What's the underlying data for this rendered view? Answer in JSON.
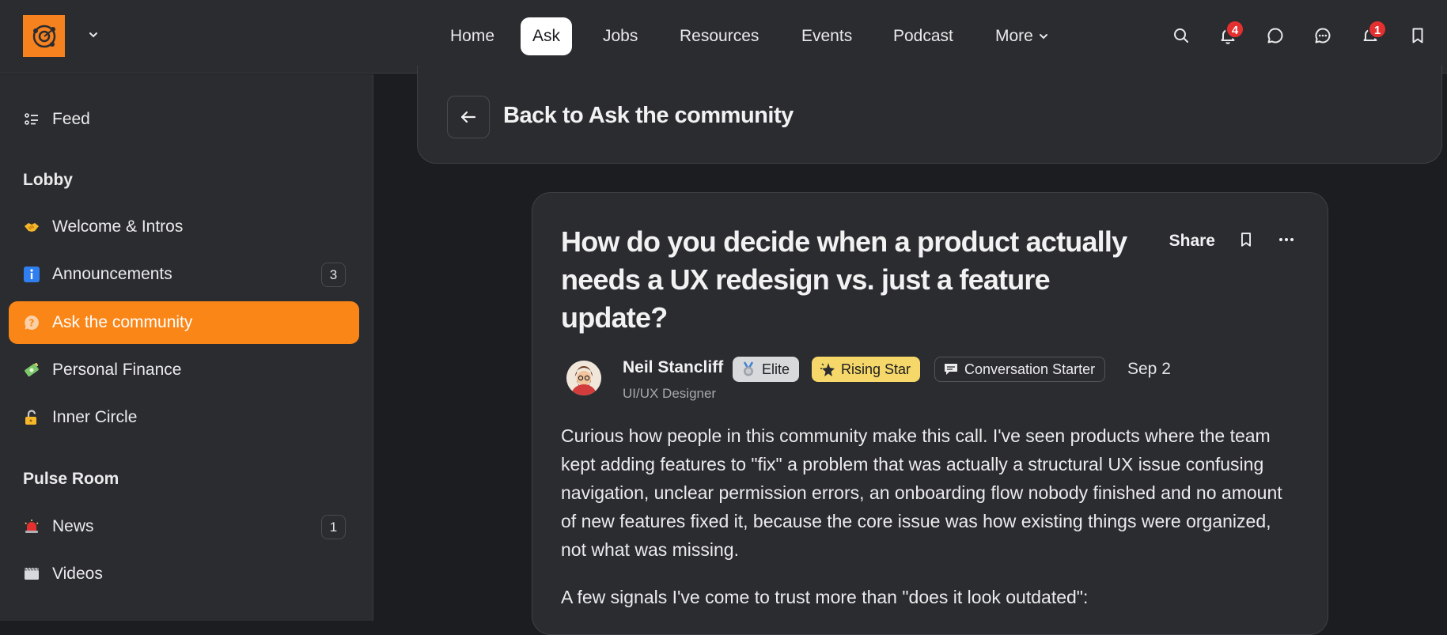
{
  "topbar": {
    "nav": [
      {
        "label": "Home",
        "active": false
      },
      {
        "label": "Ask",
        "active": true
      },
      {
        "label": "Jobs",
        "active": false
      },
      {
        "label": "Resources",
        "active": false
      },
      {
        "label": "Events",
        "active": false
      },
      {
        "label": "Podcast",
        "active": false
      },
      {
        "label": "More",
        "active": false
      }
    ],
    "icons": [
      "search-icon",
      "notifications-icon",
      "chat-icon",
      "messages-icon",
      "activity-icon",
      "bookmark-icon"
    ],
    "notification_badge": "4",
    "activity_badge": "1",
    "brand_color": "#f5821f"
  },
  "sidebar": {
    "feed_label": "Feed",
    "lobby_heading": "Lobby",
    "lobby_items": [
      {
        "label": "Welcome & Intros",
        "icon": "handshake-icon",
        "count": ""
      },
      {
        "label": "Announcements",
        "icon": "info-icon",
        "count": "3"
      },
      {
        "label": "Ask the community",
        "icon": "question-icon",
        "count": "",
        "active": true
      },
      {
        "label": "Personal Finance",
        "icon": "money-icon",
        "count": ""
      },
      {
        "label": "Inner Circle",
        "icon": "lock-icon",
        "count": ""
      }
    ],
    "pulse_heading": "Pulse Room",
    "pulse_items": [
      {
        "label": "News",
        "icon": "siren-icon",
        "count": "1"
      },
      {
        "label": "Videos",
        "icon": "video-icon",
        "count": ""
      }
    ],
    "active_color": "#fa8618"
  },
  "back": {
    "label": "Back to Ask the community"
  },
  "post": {
    "title": "How do you decide when a product actually needs a UX redesign vs. just a feature update?",
    "share_label": "Share",
    "author": {
      "name": "Neil Stancliff",
      "role": "UI/UX Designer"
    },
    "badges": [
      {
        "label": "Elite",
        "icon": "medal-icon"
      },
      {
        "label": "Rising Star",
        "icon": "star-icon"
      },
      {
        "label": "Conversation Starter",
        "icon": "speech-icon"
      }
    ],
    "date": "Sep 2",
    "body": [
      "Curious how people in this community make this call. I've seen products where the team kept adding features to \"fix\" a problem that was actually a structural UX issue confusing navigation, unclear permission errors, an onboarding flow nobody finished and no amount of new features fixed it, because the core issue was how existing things were organized, not what was missing.",
      "A few signals I've come to trust more than \"does it look outdated\":"
    ]
  }
}
